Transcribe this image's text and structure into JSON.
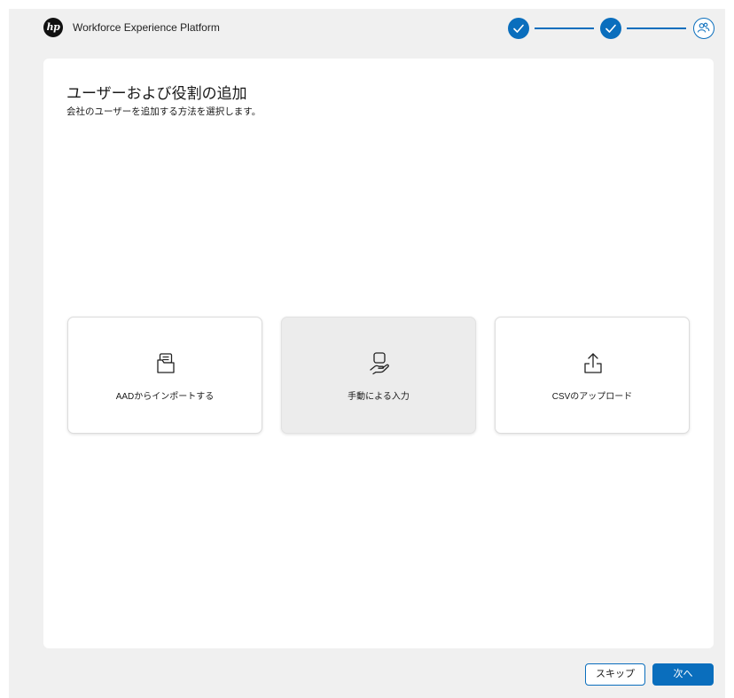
{
  "header": {
    "logo_text": "hp",
    "app_title": "Workforce Experience Platform"
  },
  "stepper": {
    "steps": [
      {
        "state": "completed",
        "icon": "checkmark-icon"
      },
      {
        "state": "completed",
        "icon": "checkmark-icon"
      },
      {
        "state": "current",
        "icon": "users-icon"
      }
    ]
  },
  "page": {
    "title": "ユーザーおよび役割の追加",
    "subtitle": "会社のユーザーを追加する方法を選択します。"
  },
  "options": [
    {
      "label": "AADからインポートする",
      "icon": "folder-import-icon"
    },
    {
      "label": "手動による入力",
      "icon": "hand-input-icon"
    },
    {
      "label": "CSVのアップロード",
      "icon": "upload-icon"
    }
  ],
  "footer": {
    "skip_label": "スキップ",
    "next_label": "次へ"
  },
  "colors": {
    "accent": "#0a6ebd",
    "background": "#f0f0f0",
    "card": "#ffffff",
    "option_hover": "#ececec"
  }
}
